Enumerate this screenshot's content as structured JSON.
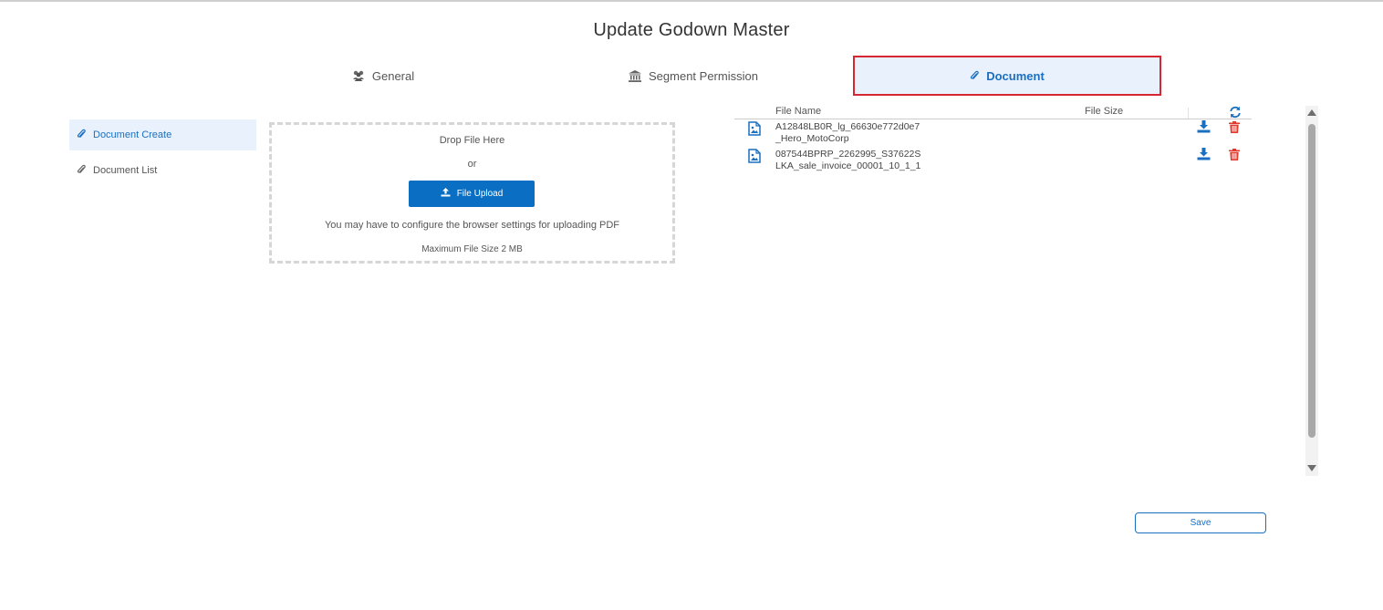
{
  "page": {
    "title": "Update Godown Master"
  },
  "tabs": {
    "general": {
      "label": "General",
      "icon": "users-icon"
    },
    "segment": {
      "label": "Segment Permission",
      "icon": "bank-icon"
    },
    "document": {
      "label": "Document",
      "icon": "paperclip-icon",
      "active": true
    }
  },
  "sidebar": {
    "items": [
      {
        "label": "Document Create",
        "icon": "paperclip-icon",
        "active": true
      },
      {
        "label": "Document List",
        "icon": "paperclip-icon",
        "active": false
      }
    ]
  },
  "upload": {
    "drop_text": "Drop File Here",
    "or_text": "or",
    "button_label": "File Upload",
    "note": "You may have to configure the browser settings for uploading PDF",
    "max_size": "Maximum File Size 2 MB"
  },
  "files": {
    "headers": {
      "name": "File Name",
      "size": "File Size"
    },
    "rows": [
      {
        "name": "A12848LB0R_lg_66630e772d0e7_Hero_MotoCorp",
        "size": ""
      },
      {
        "name": "087544BPRP_2262995_S37622SLKA_sale_invoice_00001_10_1_1",
        "size": ""
      }
    ]
  },
  "footer": {
    "save_label": "Save"
  },
  "colors": {
    "accent": "#0a6fc2",
    "active_tab_bg": "#e9f1fc",
    "highlight_border": "#d62632",
    "delete": "#e03a2f"
  }
}
